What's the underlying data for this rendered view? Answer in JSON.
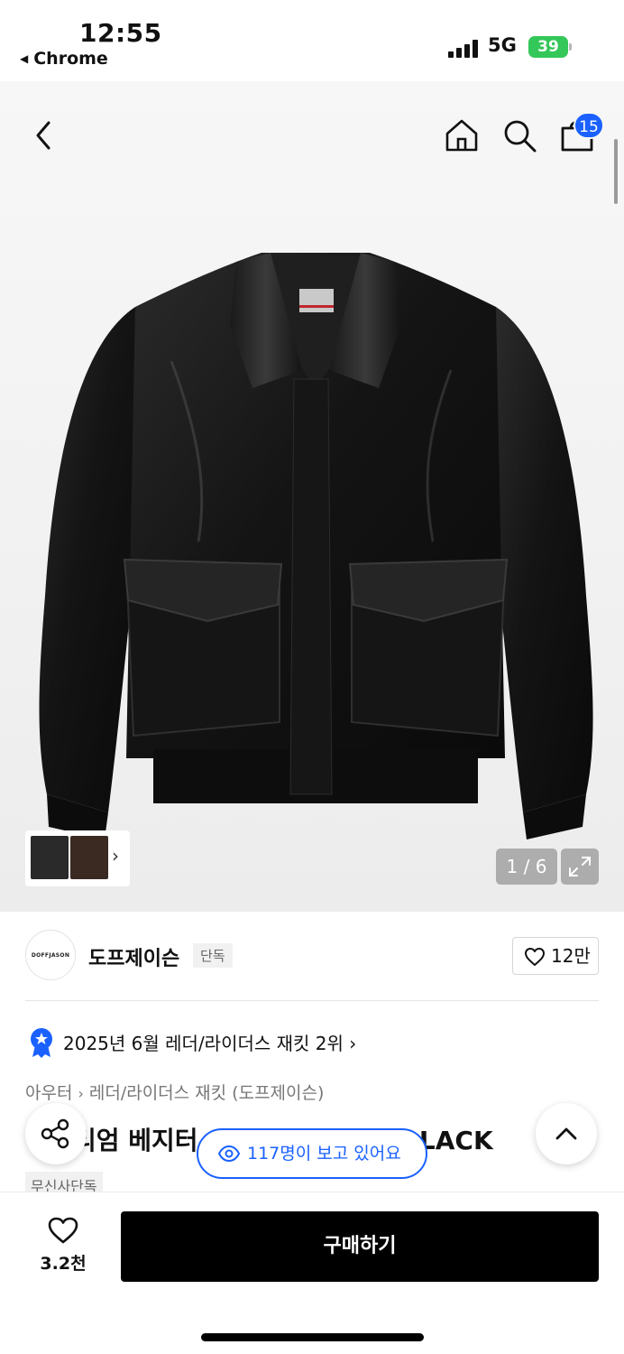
{
  "status_bar": {
    "time": "12:55",
    "back_app": "Chrome",
    "network": "5G",
    "battery": "39"
  },
  "header": {
    "cart_count": "15",
    "icons": [
      "back-arrow-icon",
      "home-icon",
      "search-icon",
      "shopping-bag-icon"
    ]
  },
  "gallery": {
    "counter": "1 / 6"
  },
  "brand": {
    "logo_text": "DOFFJASON",
    "name": "도프제이슨",
    "tag": "단독",
    "likes": "12만"
  },
  "ranking": {
    "text": "2025년 6월 레더/라이더스 재킷 2위 ›"
  },
  "breadcrumb": {
    "category": "아우터",
    "subcategory": "레더/라이더스 재킷 (도프제이슨)"
  },
  "product": {
    "title": "프리미엄 베지터블 쿠레싱 2-3 자켓 BLACK",
    "visible_title_start": "",
    "title_middle": "리엄 베지터",
    "title_end": "BLACK",
    "exclusive": "무신사단독"
  },
  "floating": {
    "viewers": "117명이 보고 있어요"
  },
  "bottom": {
    "wish_count": "3.2천",
    "buy_label": "구매하기"
  }
}
